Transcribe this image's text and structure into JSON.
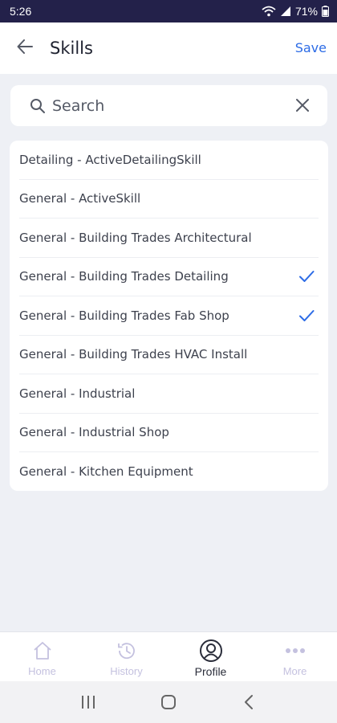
{
  "status_bar": {
    "time": "5:26",
    "battery": "71%"
  },
  "header": {
    "title": "Skills",
    "save_label": "Save"
  },
  "search": {
    "placeholder": "Search",
    "value": ""
  },
  "skills": [
    {
      "label": "Detailing - ActiveDetailingSkill",
      "selected": false
    },
    {
      "label": "General - ActiveSkill",
      "selected": false
    },
    {
      "label": "General - Building Trades Architectural",
      "selected": false
    },
    {
      "label": "General - Building Trades Detailing",
      "selected": true
    },
    {
      "label": "General - Building Trades Fab Shop",
      "selected": true
    },
    {
      "label": "General - Building Trades HVAC Install",
      "selected": false
    },
    {
      "label": "General - Industrial",
      "selected": false
    },
    {
      "label": "General - Industrial Shop",
      "selected": false
    },
    {
      "label": "General - Kitchen Equipment",
      "selected": false
    }
  ],
  "bottom_nav": [
    {
      "label": "Home",
      "icon": "home-icon",
      "active": false
    },
    {
      "label": "History",
      "icon": "history-icon",
      "active": false
    },
    {
      "label": "Profile",
      "icon": "profile-icon",
      "active": true
    },
    {
      "label": "More",
      "icon": "more-icon",
      "active": false
    }
  ],
  "colors": {
    "accent": "#2d6ce6",
    "status_bar": "#23214a",
    "inactive_nav": "#c4c1df"
  }
}
